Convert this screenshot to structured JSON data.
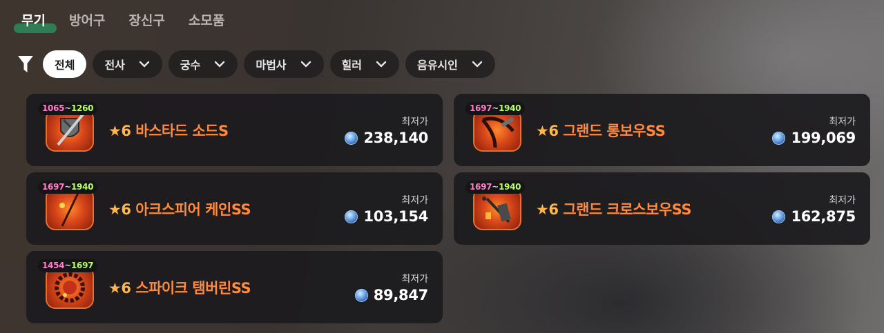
{
  "tabs": [
    {
      "label": "무기",
      "active": true
    },
    {
      "label": "방어구",
      "active": false
    },
    {
      "label": "장신구",
      "active": false
    },
    {
      "label": "소모품",
      "active": false
    }
  ],
  "filters": [
    {
      "label": "전체",
      "active": true,
      "has_dropdown": false
    },
    {
      "label": "전사",
      "active": false,
      "has_dropdown": true
    },
    {
      "label": "궁수",
      "active": false,
      "has_dropdown": true
    },
    {
      "label": "마법사",
      "active": false,
      "has_dropdown": true
    },
    {
      "label": "힐러",
      "active": false,
      "has_dropdown": true
    },
    {
      "label": "음유시인",
      "active": false,
      "has_dropdown": true
    }
  ],
  "items": [
    {
      "range_low": "1065",
      "range_sep": "~",
      "range_high": "1260",
      "star": "★6",
      "name": "바스타드 소드S",
      "price_label": "최저가",
      "price": "238,140",
      "icon": "greatsword-shield-icon"
    },
    {
      "range_low": "1697",
      "range_sep": "~",
      "range_high": "1940",
      "star": "★6",
      "name": "그랜드 롱보우SS",
      "price_label": "최저가",
      "price": "199,069",
      "icon": "longbow-icon"
    },
    {
      "range_low": "1697",
      "range_sep": "~",
      "range_high": "1940",
      "star": "★6",
      "name": "아크스피어 케인SS",
      "price_label": "최저가",
      "price": "103,154",
      "icon": "cane-icon"
    },
    {
      "range_low": "1697",
      "range_sep": "~",
      "range_high": "1940",
      "star": "★6",
      "name": "그랜드 크로스보우SS",
      "price_label": "최저가",
      "price": "162,875",
      "icon": "crossbow-icon"
    },
    {
      "range_low": "1454",
      "range_sep": "~",
      "range_high": "1697",
      "star": "★6",
      "name": "스파이크 탬버린SS",
      "price_label": "최저가",
      "price": "89,847",
      "icon": "tambourine-icon"
    }
  ],
  "colors": {
    "accent_tab": "#2f7d55",
    "item_name": "#ff8a3d",
    "range_low": "#ff7ec8",
    "range_high": "#b8ff6a"
  }
}
